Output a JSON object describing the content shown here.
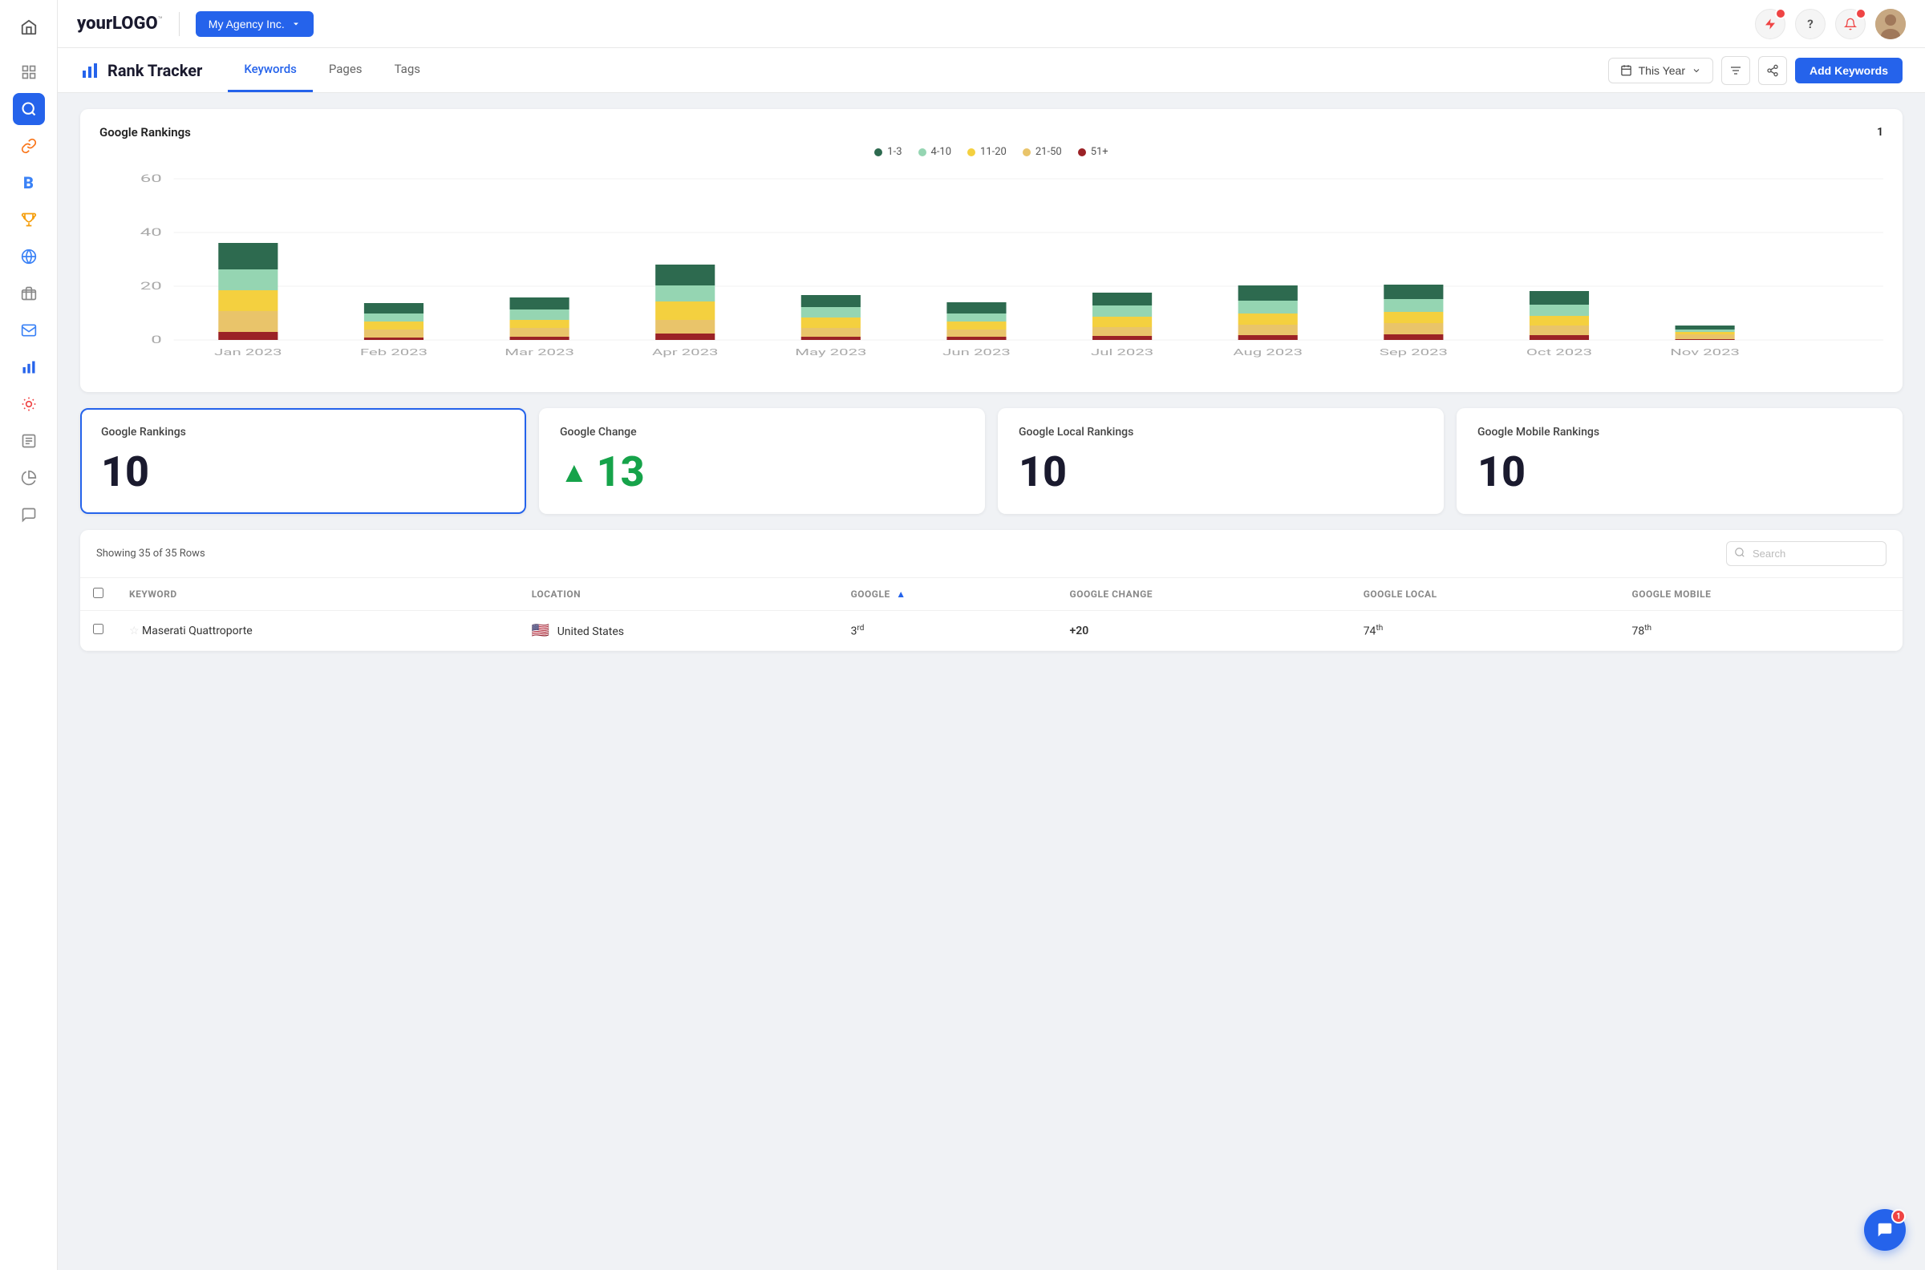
{
  "app": {
    "logo_plain": "your",
    "logo_bold": "LOGO",
    "logo_tm": "™",
    "agency_name": "My Agency Inc.",
    "page_title": "Rank Tracker"
  },
  "header_icons": {
    "bolt_label": "bolt",
    "help_label": "?",
    "bell_label": "bell"
  },
  "tabs": [
    {
      "id": "keywords",
      "label": "Keywords",
      "active": true
    },
    {
      "id": "pages",
      "label": "Pages",
      "active": false
    },
    {
      "id": "tags",
      "label": "Tags",
      "active": false
    }
  ],
  "toolbar": {
    "date_range": "This Year",
    "add_keywords": "Add Keywords"
  },
  "chart": {
    "title": "Google Rankings",
    "badge": "1",
    "legend": [
      {
        "id": "1-3",
        "label": "1-3",
        "color": "#2d6a4f"
      },
      {
        "id": "4-10",
        "label": "4-10",
        "color": "#95d5b2"
      },
      {
        "id": "11-20",
        "label": "11-20",
        "color": "#f4d03f"
      },
      {
        "id": "21-50",
        "label": "21-50",
        "color": "#e9c46a"
      },
      {
        "id": "51+",
        "label": "51+",
        "color": "#9b2226"
      }
    ],
    "y_labels": [
      "0",
      "20",
      "40",
      "60"
    ],
    "bars": [
      {
        "month": "Jan 2023",
        "segments": [
          8,
          8,
          8,
          8,
          5
        ]
      },
      {
        "month": "Feb 2023",
        "segments": [
          4,
          3,
          3,
          2,
          1
        ]
      },
      {
        "month": "Mar 2023",
        "segments": [
          4,
          4,
          3,
          3,
          2
        ]
      },
      {
        "month": "Apr 2023",
        "segments": [
          7,
          7,
          7,
          5,
          4
        ]
      },
      {
        "month": "May 2023",
        "segments": [
          4,
          4,
          4,
          4,
          4
        ]
      },
      {
        "month": "Jun 2023",
        "segments": [
          4,
          4,
          4,
          3,
          2
        ]
      },
      {
        "month": "Jul 2023",
        "segments": [
          5,
          5,
          4,
          4,
          3
        ]
      },
      {
        "month": "Aug 2023",
        "segments": [
          6,
          5,
          5,
          4,
          3
        ]
      },
      {
        "month": "Sep 2023",
        "segments": [
          6,
          5,
          5,
          5,
          3
        ]
      },
      {
        "month": "Oct 2023",
        "segments": [
          5,
          5,
          4,
          4,
          3
        ]
      },
      {
        "month": "Nov 2023",
        "segments": [
          2,
          2,
          1,
          1,
          1
        ]
      }
    ]
  },
  "stat_cards": [
    {
      "id": "google-rankings",
      "label": "Google Rankings",
      "value": "10",
      "type": "plain",
      "active": true
    },
    {
      "id": "google-change",
      "label": "Google Change",
      "value": "13",
      "type": "positive",
      "active": false
    },
    {
      "id": "google-local",
      "label": "Google Local Rankings",
      "value": "10",
      "type": "plain",
      "active": false
    },
    {
      "id": "google-mobile",
      "label": "Google Mobile Rankings",
      "value": "10",
      "type": "plain",
      "active": false
    }
  ],
  "table": {
    "rows_info": "Showing 35 of 35 Rows",
    "search_placeholder": "Search",
    "columns": [
      "KEYWORD",
      "LOCATION",
      "GOOGLE",
      "GOOGLE CHANGE",
      "GOOGLE LOCAL",
      "GOOGLE MOBILE"
    ],
    "rows": [
      {
        "keyword": "Maserati Quattroporte",
        "location": "United States",
        "google": "3rd",
        "google_change": "+20",
        "google_local": "74th",
        "google_mobile": "78th"
      }
    ]
  },
  "chat": {
    "badge": "1"
  },
  "sidebar_icons": [
    {
      "id": "home",
      "icon": "⌂",
      "active": false
    },
    {
      "id": "grid",
      "icon": "⊞",
      "active": false
    },
    {
      "id": "search",
      "icon": "🔍",
      "active": true
    },
    {
      "id": "anchor",
      "icon": "⚓",
      "active": false
    },
    {
      "id": "b-icon",
      "icon": "ℬ",
      "active": false
    },
    {
      "id": "trophy",
      "icon": "🏆",
      "active": false
    },
    {
      "id": "globe",
      "icon": "🌐",
      "active": false
    },
    {
      "id": "box",
      "icon": "📦",
      "active": false
    },
    {
      "id": "envelope",
      "icon": "M",
      "active": false
    },
    {
      "id": "chart-bar",
      "icon": "📊",
      "active": false
    },
    {
      "id": "fish",
      "icon": "🐟",
      "active": false
    },
    {
      "id": "newspaper",
      "icon": "📰",
      "active": false
    },
    {
      "id": "pie-chart",
      "icon": "◑",
      "active": false
    },
    {
      "id": "chat-bubble",
      "icon": "💬",
      "active": false
    }
  ]
}
